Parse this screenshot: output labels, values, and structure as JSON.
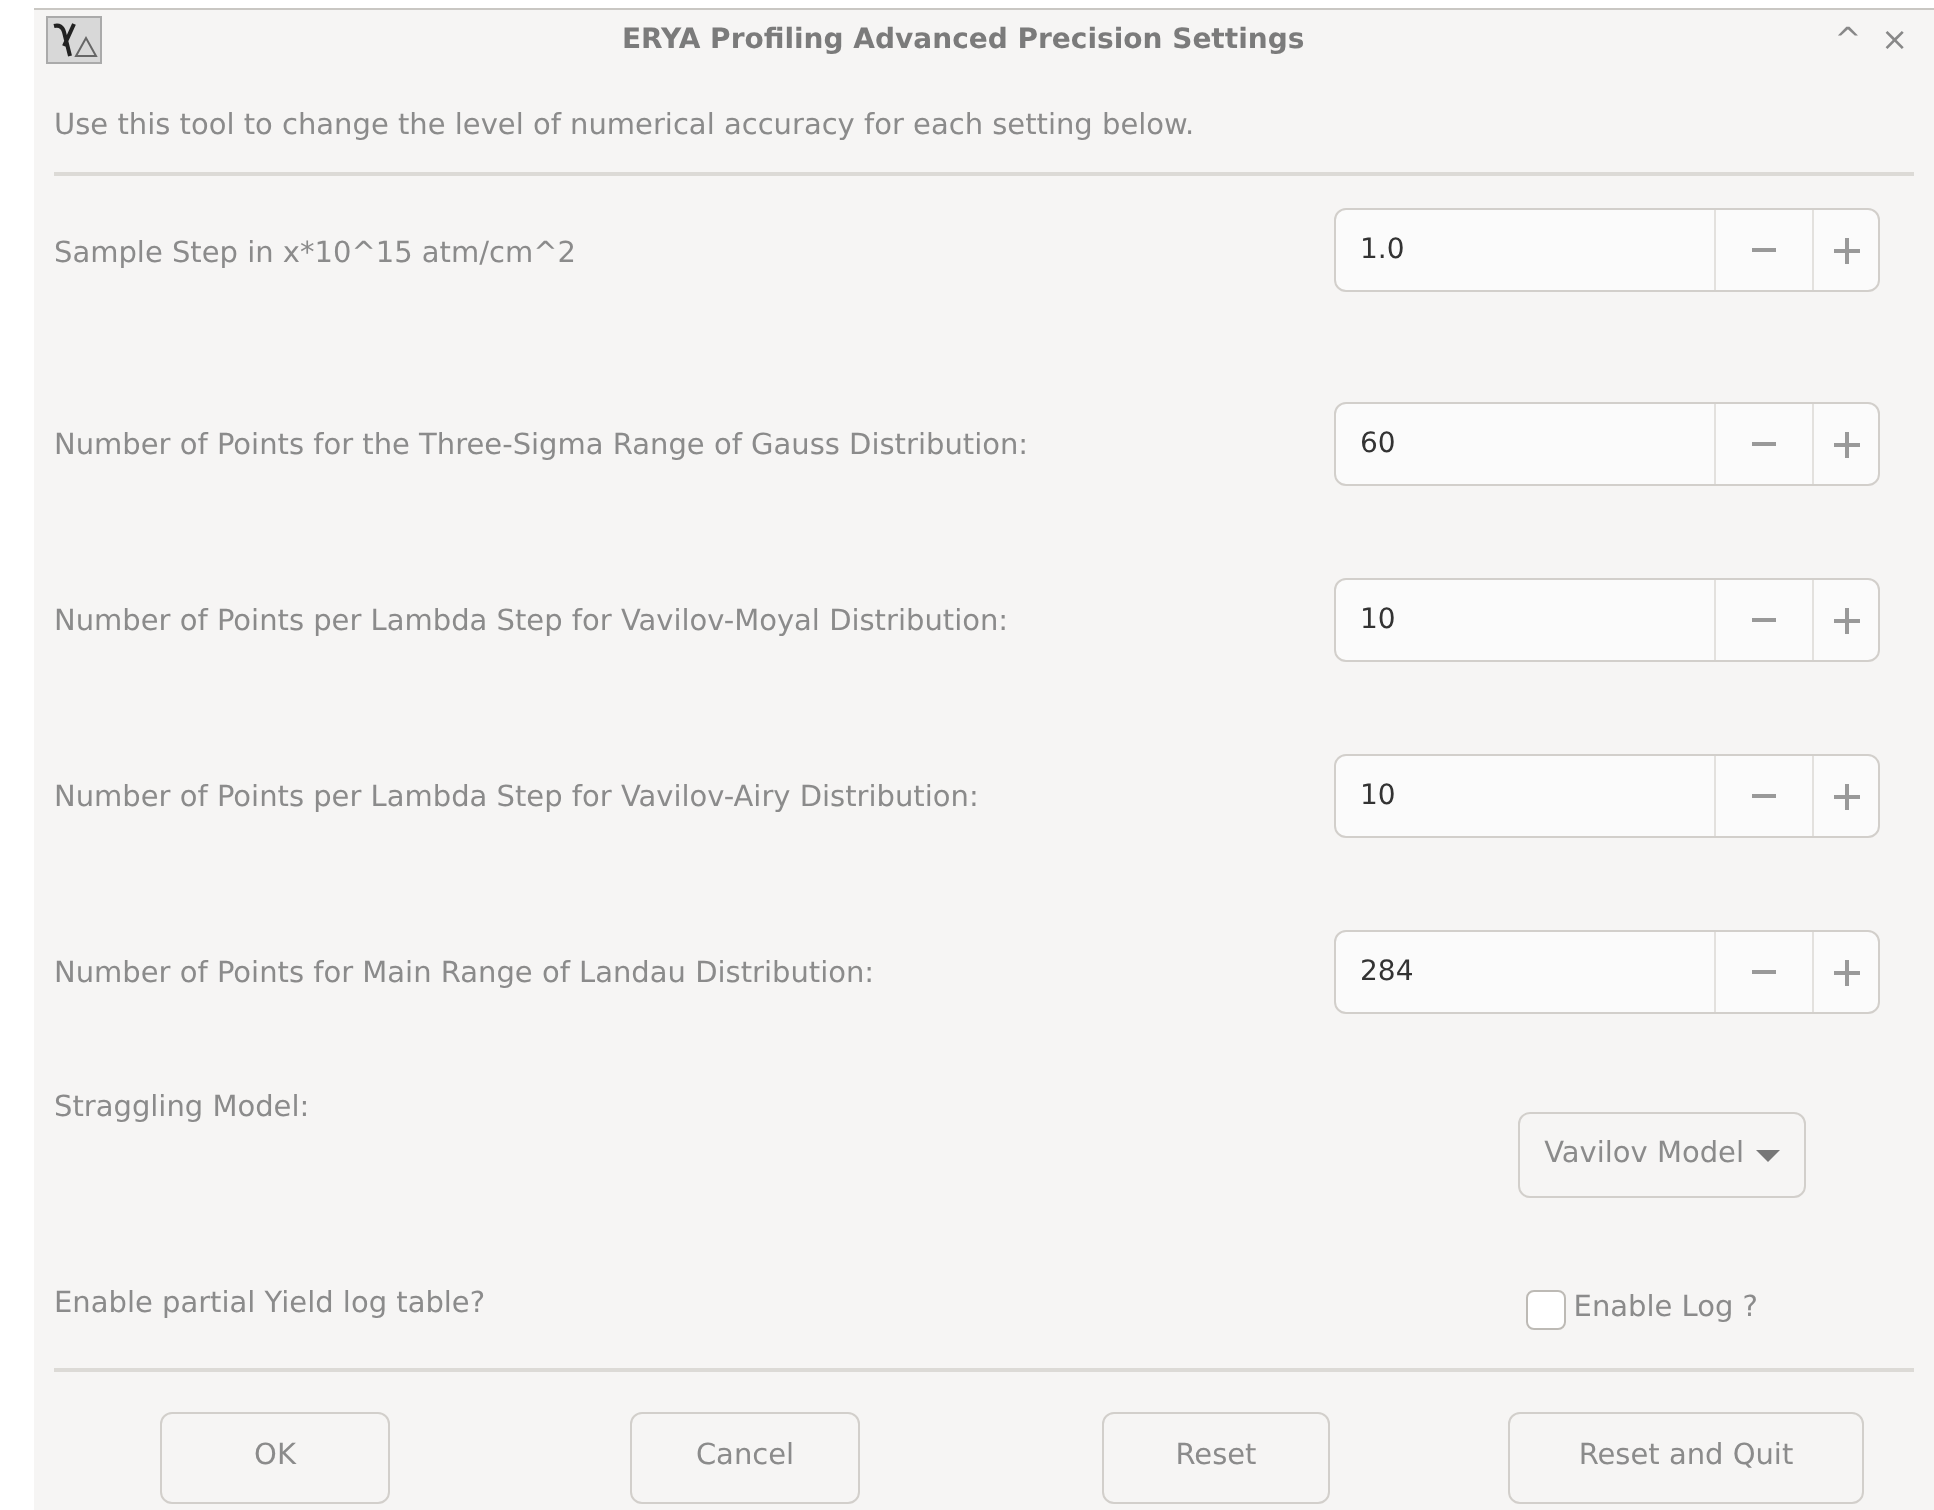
{
  "window": {
    "title": "ERYA Profiling Advanced Precision Settings",
    "controls": [
      "^",
      "×"
    ]
  },
  "description": "Use this tool to change the level of numerical accuracy for each setting below.",
  "settings": [
    {
      "label": "Sample Step in x*10^15 atm/cm^2",
      "value": "1.0"
    },
    {
      "label": "Number of Points for the Three-Sigma Range of Gauss Distribution:",
      "value": "60"
    },
    {
      "label": "Number of Points per Lambda Step for Vavilov-Moyal Distribution:",
      "value": "10"
    },
    {
      "label": "Number of Points per Lambda Step for Vavilov-Airy Distribution:",
      "value": "10"
    },
    {
      "label": "Number of Points for Main Range of Landau Distribution:",
      "value": "284"
    }
  ],
  "straggling": {
    "label": "Straggling Model:",
    "value": "Vavilov Model"
  },
  "log": {
    "label": "Enable partial Yield log table?",
    "checkbox_label": "Enable Log ?",
    "checked": false
  },
  "buttons": [
    "OK",
    "Cancel",
    "Reset",
    "Reset and Quit"
  ]
}
